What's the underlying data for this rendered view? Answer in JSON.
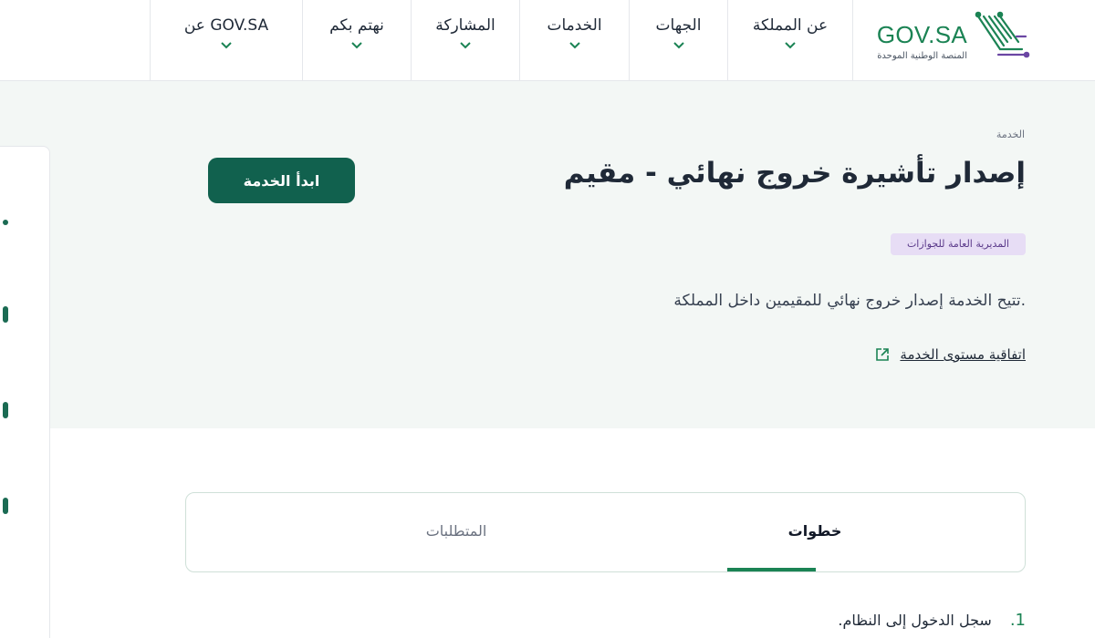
{
  "header": {
    "logo_text": "GOV.SA",
    "logo_subtitle": "المنصة الوطنية الموحدة",
    "nav": [
      {
        "label": "عن المملكة"
      },
      {
        "label": "الجهات"
      },
      {
        "label": "الخدمات"
      },
      {
        "label": "المشاركة"
      },
      {
        "label": "نهتم بكم"
      },
      {
        "label": "عن GOV.SA"
      }
    ]
  },
  "service": {
    "breadcrumb": "الخدمة",
    "title": "إصدار تأشيرة خروج نهائي - مقيم",
    "start_button": "ابدأ الخدمة",
    "agency": "المديرية العامة للجوازات",
    "description": "تتيح الخدمة إصدار خروج نهائي للمقيمين داخل المملكة.",
    "sla_link": "اتفاقية مستوى الخدمة"
  },
  "tabs": {
    "steps": "خطوات",
    "requirements": "المتطلبات"
  },
  "steps": [
    {
      "number": "1.",
      "text": "سجل الدخول إلى النظام."
    }
  ],
  "colors": {
    "brand_green": "#1b8354",
    "button_green": "#11614e",
    "hero_bg": "#f3f7f5",
    "badge_bg": "#e7ddf5"
  }
}
